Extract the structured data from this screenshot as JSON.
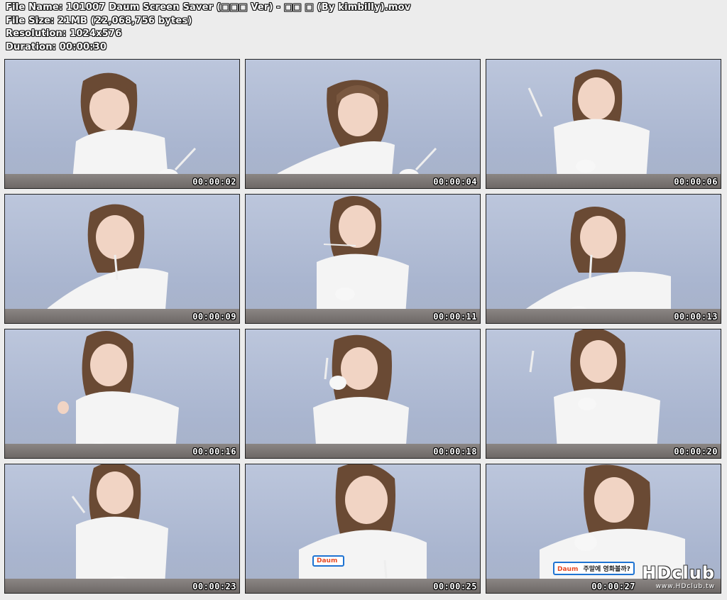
{
  "info": {
    "file_name": "File Name: 101007 Daum Screen Saver (□□□ Ver) - □□ □ (By kimbilly).mov",
    "file_size": "File Size: 21MB (22,068,756 bytes)",
    "resolution": "Resolution: 1024x576",
    "duration": "Duration: 00:00:30"
  },
  "thumbnails": [
    {
      "timestamp": "00:00:02"
    },
    {
      "timestamp": "00:00:04"
    },
    {
      "timestamp": "00:00:06"
    },
    {
      "timestamp": "00:00:09"
    },
    {
      "timestamp": "00:00:11"
    },
    {
      "timestamp": "00:00:13"
    },
    {
      "timestamp": "00:00:16"
    },
    {
      "timestamp": "00:00:18"
    },
    {
      "timestamp": "00:00:20"
    },
    {
      "timestamp": "00:00:23"
    },
    {
      "timestamp": "00:00:25"
    },
    {
      "timestamp": "00:00:27"
    }
  ],
  "banners": {
    "frame_11": {
      "brand": "Daum",
      "text": ""
    },
    "frame_12": {
      "brand": "Daum",
      "text": "주말에 영화볼까?"
    }
  },
  "watermark": {
    "logo": "HDclub",
    "url": "www.HDclub.tw"
  }
}
